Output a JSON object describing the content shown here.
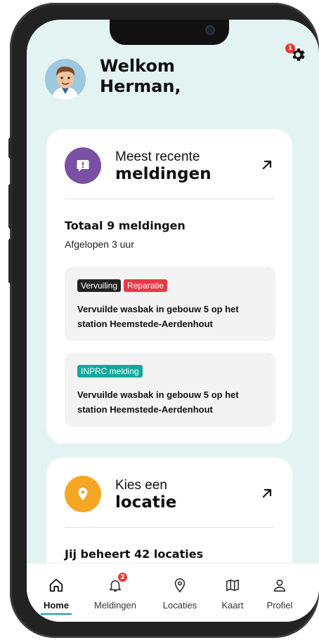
{
  "header": {
    "greeting_line1": "Welkom",
    "greeting_line2": "Herman,",
    "settings_badge": "1"
  },
  "recent_card": {
    "title_line1": "Meest recente",
    "title_line2": "meldingen",
    "total": "Totaal 9 meldingen",
    "period": "Afgelopen 3 uur",
    "accent_color": "#7b4fa2",
    "items": [
      {
        "tags": [
          {
            "label": "Vervuiling",
            "color": "#222222"
          },
          {
            "label": "Reparatie",
            "color": "#e53947"
          }
        ],
        "text": "Vervuilde wasbak in gebouw 5 op het station Heemstede-Aerdenhout"
      },
      {
        "tags": [
          {
            "label": "INPRC melding",
            "color": "#13a89e"
          }
        ],
        "text": "Vervuilde wasbak in gebouw 5 op het station Heemstede-Aerdenhout"
      }
    ]
  },
  "location_card": {
    "title_line1": "Kies een",
    "title_line2": "locatie",
    "summary": "Jij beheert 42 locaties",
    "accent_color": "#f5a623"
  },
  "nav": {
    "home": "Home",
    "notifications": "Meldingen",
    "notifications_badge": "2",
    "locations": "Locaties",
    "map": "Kaart",
    "profile": "Profiel",
    "active_color": "#1a9c94"
  },
  "icons": {
    "settings": "gear-icon",
    "alert": "message-alert-icon",
    "location": "map-pin-icon",
    "arrow": "arrow-up-right-icon"
  }
}
